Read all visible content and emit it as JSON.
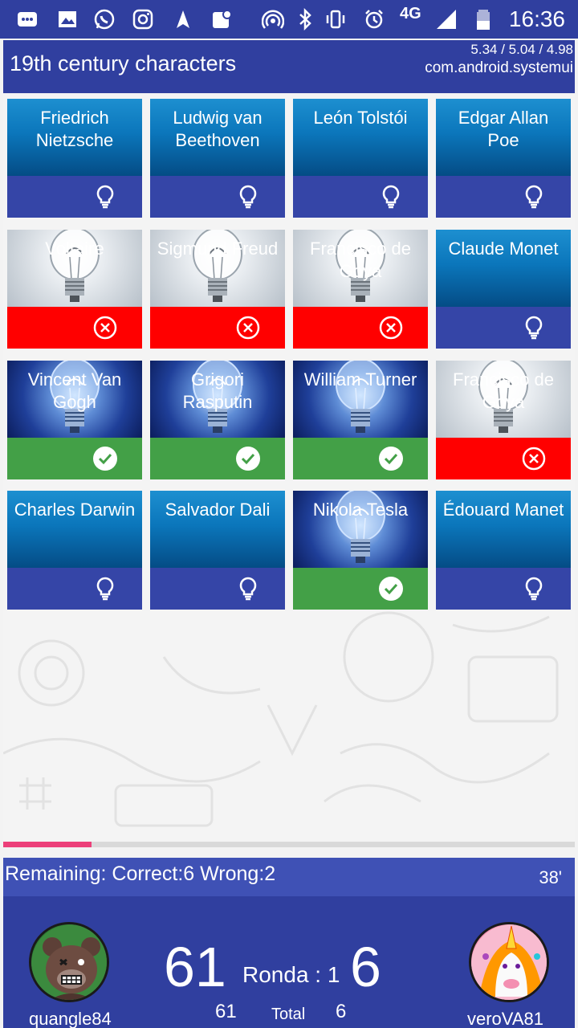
{
  "status_bar": {
    "time": "16:36",
    "network": "4G",
    "icons": [
      "message-icon",
      "image-icon",
      "whatsapp-icon",
      "instagram-icon",
      "navigation-icon",
      "maps-icon",
      "hotspot-icon",
      "bluetooth-icon",
      "vibrate-icon",
      "alarm-icon",
      "signal-icon",
      "battery-icon"
    ]
  },
  "app_bar": {
    "title": "19th century characters",
    "overlay_load": "5.34 / 5.04 / 4.98",
    "overlay_process": "com.android.systemui"
  },
  "tiles": [
    {
      "name": "Friedrich Nietzsche",
      "image": "blue",
      "state": "neutral",
      "icon": "lightbulb-icon"
    },
    {
      "name": "Ludwig van Beethoven",
      "image": "blue",
      "state": "neutral",
      "icon": "lightbulb-icon"
    },
    {
      "name": "León Tolstói",
      "image": "blue",
      "state": "neutral",
      "icon": "lightbulb-icon"
    },
    {
      "name": "Edgar Allan Poe",
      "image": "blue",
      "state": "neutral",
      "icon": "lightbulb-icon"
    },
    {
      "name": "Voltaire",
      "image": "bulb-grey",
      "state": "wrong",
      "icon": "x-circle-icon"
    },
    {
      "name": "Sigmund Freud",
      "image": "bulb-grey",
      "state": "wrong",
      "icon": "x-circle-icon"
    },
    {
      "name": "Francisco de Goya",
      "image": "bulb-grey",
      "state": "wrong",
      "icon": "x-circle-icon"
    },
    {
      "name": "Claude Monet",
      "image": "blue",
      "state": "neutral",
      "icon": "lightbulb-icon"
    },
    {
      "name": "Vincent Van Gogh",
      "image": "bulb-blue",
      "state": "right",
      "icon": "check-circle-icon"
    },
    {
      "name": "Grigori Rasputin",
      "image": "bulb-blue",
      "state": "right",
      "icon": "check-circle-icon"
    },
    {
      "name": "William Turner",
      "image": "bulb-blue",
      "state": "right",
      "icon": "check-circle-icon"
    },
    {
      "name": "Francisco de Goya",
      "image": "bulb-grey",
      "state": "wrong",
      "icon": "x-circle-icon"
    },
    {
      "name": "Charles Darwin",
      "image": "blue",
      "state": "neutral",
      "icon": "lightbulb-icon"
    },
    {
      "name": "Salvador Dali",
      "image": "blue",
      "state": "neutral",
      "icon": "lightbulb-icon"
    },
    {
      "name": "Nikola Tesla",
      "image": "bulb-blue",
      "state": "right",
      "icon": "check-circle-icon"
    },
    {
      "name": "Édouard Manet",
      "image": "blue",
      "state": "neutral",
      "icon": "lightbulb-icon"
    }
  ],
  "progress": {
    "fraction": 0.155
  },
  "info_bar": {
    "remaining": "Remaining:  Correct:6  Wrong:2",
    "timer": "38'"
  },
  "score_panel": {
    "player1": {
      "name": "quangle84",
      "score": "61",
      "total": "61"
    },
    "player2": {
      "name": "veroVA81",
      "score": "6",
      "total": "6"
    },
    "round": "Ronda : 1",
    "total_label": "Total"
  },
  "colors": {
    "primary": "#303f9f",
    "tile_bar": "#3545a7",
    "correct": "#43a047",
    "wrong": "#ff0000",
    "progress": "#ec407a"
  }
}
